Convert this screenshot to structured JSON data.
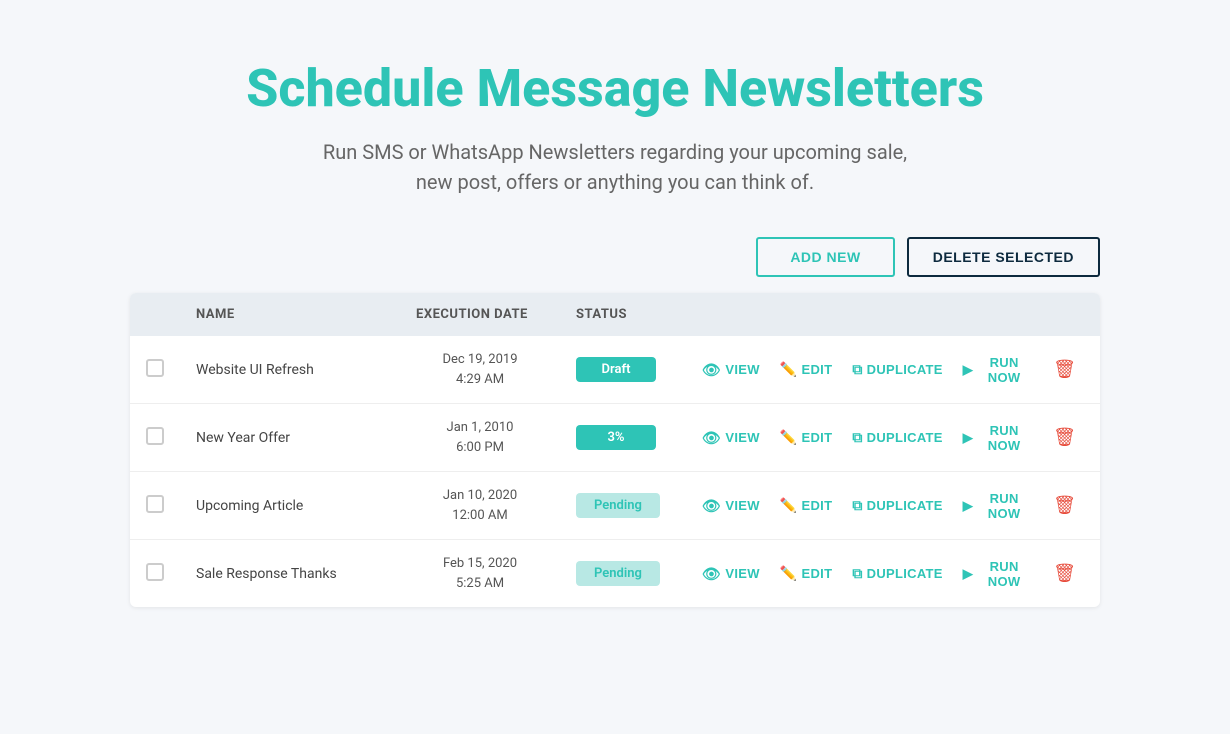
{
  "header": {
    "title_part1": "Schedule Message ",
    "title_part2": "Newsletters",
    "subtitle": "Run SMS or WhatsApp Newsletters regarding your upcoming sale,\nnew post, offers or anything you can think of."
  },
  "toolbar": {
    "add_new_label": "ADD NEW",
    "delete_selected_label": "DELETE SELECTED"
  },
  "table": {
    "columns": [
      {
        "key": "checkbox",
        "label": ""
      },
      {
        "key": "name",
        "label": "NAME"
      },
      {
        "key": "execution_date",
        "label": "EXECUTION DATE"
      },
      {
        "key": "status",
        "label": "STATUS"
      },
      {
        "key": "actions",
        "label": ""
      }
    ],
    "rows": [
      {
        "id": 1,
        "name": "Website UI Refresh",
        "date_line1": "Dec 19, 2019",
        "date_line2": "4:29 AM",
        "status": "Draft",
        "status_type": "draft"
      },
      {
        "id": 2,
        "name": "New Year Offer",
        "date_line1": "Jan 1, 2010",
        "date_line2": "6:00 PM",
        "status": "3%",
        "status_type": "percent"
      },
      {
        "id": 3,
        "name": "Upcoming Article",
        "date_line1": "Jan 10, 2020",
        "date_line2": "12:00 AM",
        "status": "Pending",
        "status_type": "pending"
      },
      {
        "id": 4,
        "name": "Sale Response Thanks",
        "date_line1": "Feb 15, 2020",
        "date_line2": "5:25 AM",
        "status": "Pending",
        "status_type": "pending"
      }
    ],
    "action_view": "VIEW",
    "action_edit": "EDIT",
    "action_duplicate": "DUPLICATE",
    "action_run_now": "RUN NOW"
  }
}
